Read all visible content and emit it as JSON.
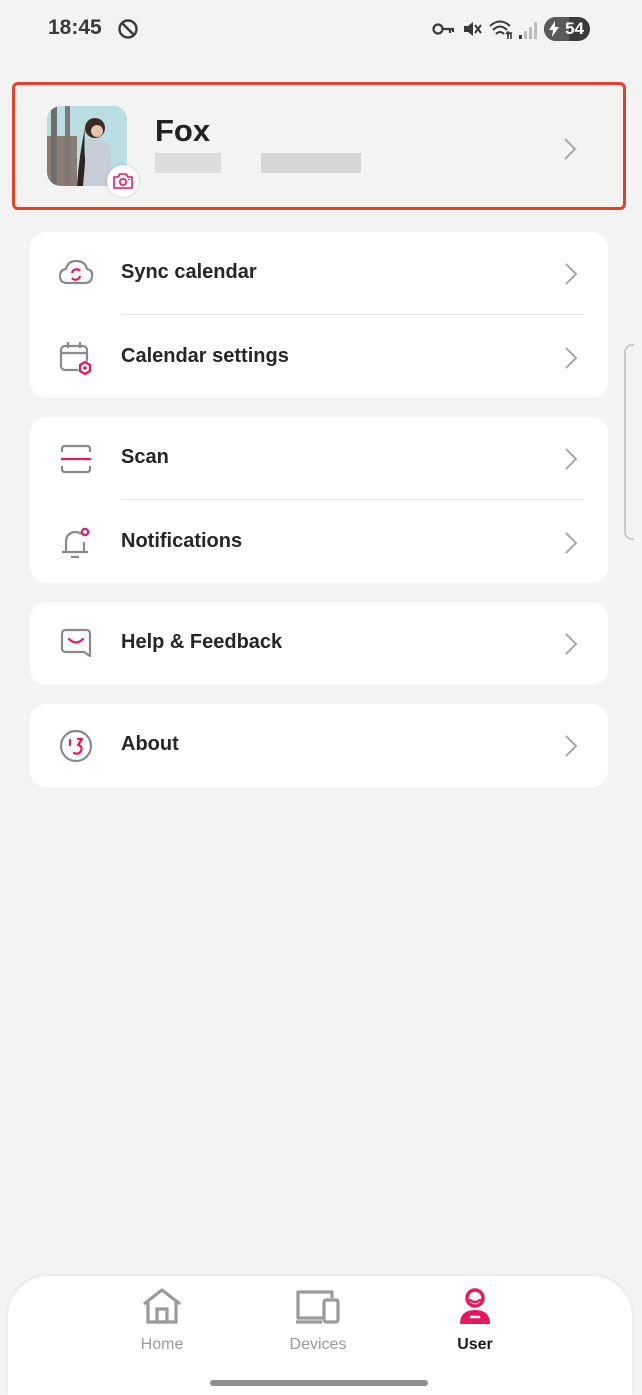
{
  "status_bar": {
    "time": "18:45",
    "battery_level": 54,
    "battery_text": "54",
    "icons": [
      "vpn-off-icon",
      "key-icon",
      "mute-icon",
      "wifi-icon",
      "signal-icon",
      "battery-icon"
    ]
  },
  "profile": {
    "name": "Fox",
    "avatar": "user-photo",
    "camera_badge": "camera-icon"
  },
  "menu": {
    "sync_calendar": "Sync calendar",
    "calendar_settings": "Calendar settings",
    "scan": "Scan",
    "notifications": "Notifications",
    "help_feedback": "Help & Feedback",
    "about": "About"
  },
  "tabs": {
    "home": "Home",
    "devices": "Devices",
    "user": "User",
    "active": "User"
  },
  "colors": {
    "accent": "#e8175d",
    "highlight_border": "#e0422c",
    "background": "#f3f3f3",
    "icon_gray": "#8a8a8a"
  }
}
